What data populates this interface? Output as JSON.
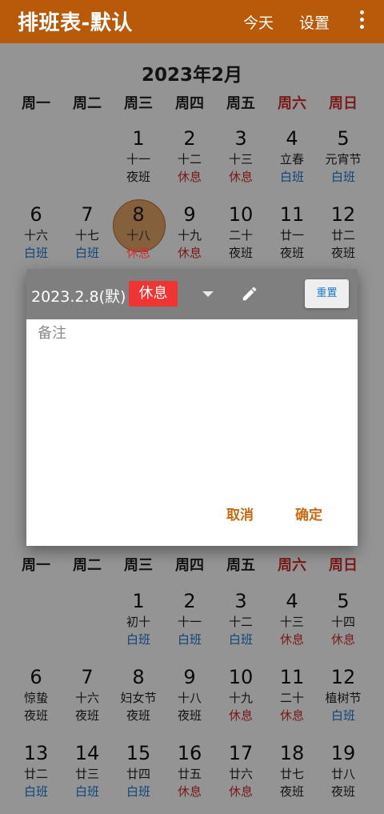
{
  "app": {
    "title": "排班表-默认",
    "today_label": "今天",
    "settings_label": "设置"
  },
  "weekdays": [
    {
      "label": "周一",
      "weekend": false
    },
    {
      "label": "周二",
      "weekend": false
    },
    {
      "label": "周三",
      "weekend": false
    },
    {
      "label": "周四",
      "weekend": false
    },
    {
      "label": "周五",
      "weekend": false
    },
    {
      "label": "周六",
      "weekend": true
    },
    {
      "label": "周日",
      "weekend": true
    }
  ],
  "months": [
    {
      "title": "2023年2月",
      "days": [
        {
          "num": "1",
          "lunar": "十一",
          "shift": "夜班"
        },
        {
          "num": "2",
          "lunar": "十二",
          "shift": "休息"
        },
        {
          "num": "3",
          "lunar": "十三",
          "shift": "休息"
        },
        {
          "num": "4",
          "lunar": "立春",
          "shift": "白班"
        },
        {
          "num": "5",
          "lunar": "元宵节",
          "shift": "白班"
        },
        {
          "num": "6",
          "lunar": "十六",
          "shift": "白班"
        },
        {
          "num": "7",
          "lunar": "十七",
          "shift": "白班"
        },
        {
          "num": "8",
          "lunar": "十八",
          "shift": "休息",
          "selected": true
        },
        {
          "num": "9",
          "lunar": "十九",
          "shift": "休息"
        },
        {
          "num": "10",
          "lunar": "二十",
          "shift": "夜班"
        },
        {
          "num": "11",
          "lunar": "廿一",
          "shift": "夜班"
        },
        {
          "num": "12",
          "lunar": "廿二",
          "shift": "夜班"
        }
      ]
    },
    {
      "title": "",
      "days": [
        {
          "num": "1",
          "lunar": "初十",
          "shift": "白班"
        },
        {
          "num": "2",
          "lunar": "十一",
          "shift": "白班"
        },
        {
          "num": "3",
          "lunar": "十二",
          "shift": "白班"
        },
        {
          "num": "4",
          "lunar": "十三",
          "shift": "休息"
        },
        {
          "num": "5",
          "lunar": "十四",
          "shift": "休息"
        },
        {
          "num": "6",
          "lunar": "惊蛰",
          "shift": "夜班"
        },
        {
          "num": "7",
          "lunar": "十六",
          "shift": "夜班"
        },
        {
          "num": "8",
          "lunar": "妇女节",
          "shift": "夜班"
        },
        {
          "num": "9",
          "lunar": "十八",
          "shift": "夜班"
        },
        {
          "num": "10",
          "lunar": "十九",
          "shift": "休息"
        },
        {
          "num": "11",
          "lunar": "二十",
          "shift": "休息"
        },
        {
          "num": "12",
          "lunar": "植树节",
          "shift": "白班"
        },
        {
          "num": "13",
          "lunar": "廿二",
          "shift": "白班"
        },
        {
          "num": "14",
          "lunar": "廿三",
          "shift": "白班"
        },
        {
          "num": "15",
          "lunar": "廿四",
          "shift": "白班"
        },
        {
          "num": "16",
          "lunar": "廿五",
          "shift": "休息"
        },
        {
          "num": "17",
          "lunar": "廿六",
          "shift": "休息"
        },
        {
          "num": "18",
          "lunar": "廿七",
          "shift": "夜班"
        },
        {
          "num": "19",
          "lunar": "廿八",
          "shift": "夜班"
        }
      ]
    }
  ],
  "shift_colors": {
    "休息": "#d32f2f",
    "白班": "#1976d2",
    "夜班": "#222222"
  },
  "dialog": {
    "date": "2023.2.8(默)",
    "shift": "休息",
    "shift_chip_color": "#f03333",
    "reset_label": "重置",
    "note_placeholder": "备注",
    "note_value": "",
    "cancel_label": "取消",
    "ok_label": "确定"
  },
  "icons": {
    "dropdown": "caret-down-icon",
    "edit": "pencil-icon",
    "menu": "more-vert-icon"
  },
  "colors": {
    "appbar": "#b85a0a",
    "accent": "#c96a10"
  }
}
